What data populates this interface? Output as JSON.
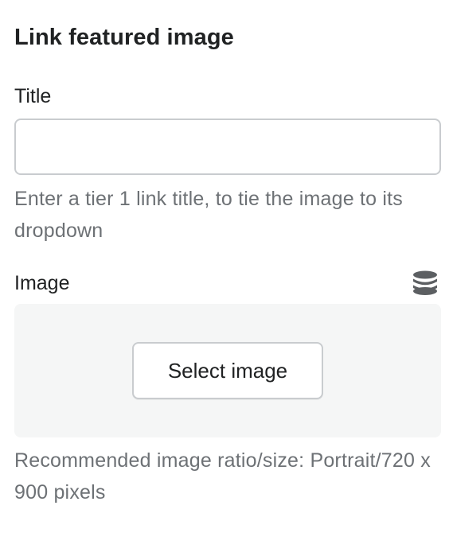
{
  "section": {
    "title": "Link featured image"
  },
  "title_field": {
    "label": "Title",
    "value": "",
    "placeholder": "",
    "help": "Enter a tier 1 link title, to tie the image to its dropdown"
  },
  "image_field": {
    "label": "Image",
    "icon": "database-icon",
    "select_label": "Select image",
    "help": "Recommended image ratio/size: Portrait/720 x 900 pixels"
  }
}
